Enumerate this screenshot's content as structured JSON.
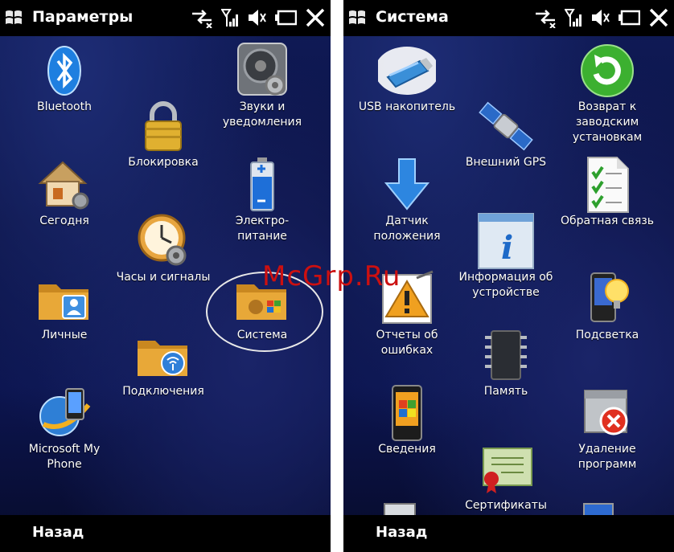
{
  "left": {
    "title": "Параметры",
    "back": "Назад",
    "items": [
      {
        "label": "Bluetooth",
        "icon": "bluetooth-icon"
      },
      {
        "label": "Звуки и\nуведомления",
        "icon": "speaker-gear-icon"
      },
      {
        "label": "Блокировка",
        "icon": "padlock-icon"
      },
      {
        "label": "Сегодня",
        "icon": "house-icon"
      },
      {
        "label": "Электро-\nпитание",
        "icon": "battery-icon"
      },
      {
        "label": "Часы и сигналы",
        "icon": "clock-gear-icon"
      },
      {
        "label": "Личные",
        "icon": "folder-person-icon"
      },
      {
        "label": "Система",
        "icon": "folder-windows-icon"
      },
      {
        "label": "Подключения",
        "icon": "folder-wireless-icon"
      },
      {
        "label": "Microsoft My\nPhone",
        "icon": "globe-phone-icon"
      }
    ]
  },
  "right": {
    "title": "Система",
    "back": "Назад",
    "items": [
      {
        "label": "USB накопитель",
        "icon": "usb-drive-icon"
      },
      {
        "label": "Возврат к\nзаводским\nустановкам",
        "icon": "green-refresh-icon"
      },
      {
        "label": "Внешний GPS",
        "icon": "satellite-icon"
      },
      {
        "label": "Датчик\nположения",
        "icon": "down-arrow-icon"
      },
      {
        "label": "Обратная связь",
        "icon": "checklist-icon"
      },
      {
        "label": "Информация об\nустройстве",
        "icon": "info-icon"
      },
      {
        "label": "Отчеты об\nошибках",
        "icon": "warning-icon"
      },
      {
        "label": "Подсветка",
        "icon": "phone-bulb-icon"
      },
      {
        "label": "Память",
        "icon": "memory-chip-icon"
      },
      {
        "label": "Сведения",
        "icon": "phone-windows-icon"
      },
      {
        "label": "Удаление\nпрограмм",
        "icon": "remove-program-icon"
      },
      {
        "label": "Сертификаты",
        "icon": "certificate-icon"
      }
    ]
  },
  "watermark": "McGrp.Ru",
  "colors": {
    "bar": "#000000",
    "accent": "#1b2a78",
    "text": "#ffffff",
    "watermark": "#cc1010"
  }
}
